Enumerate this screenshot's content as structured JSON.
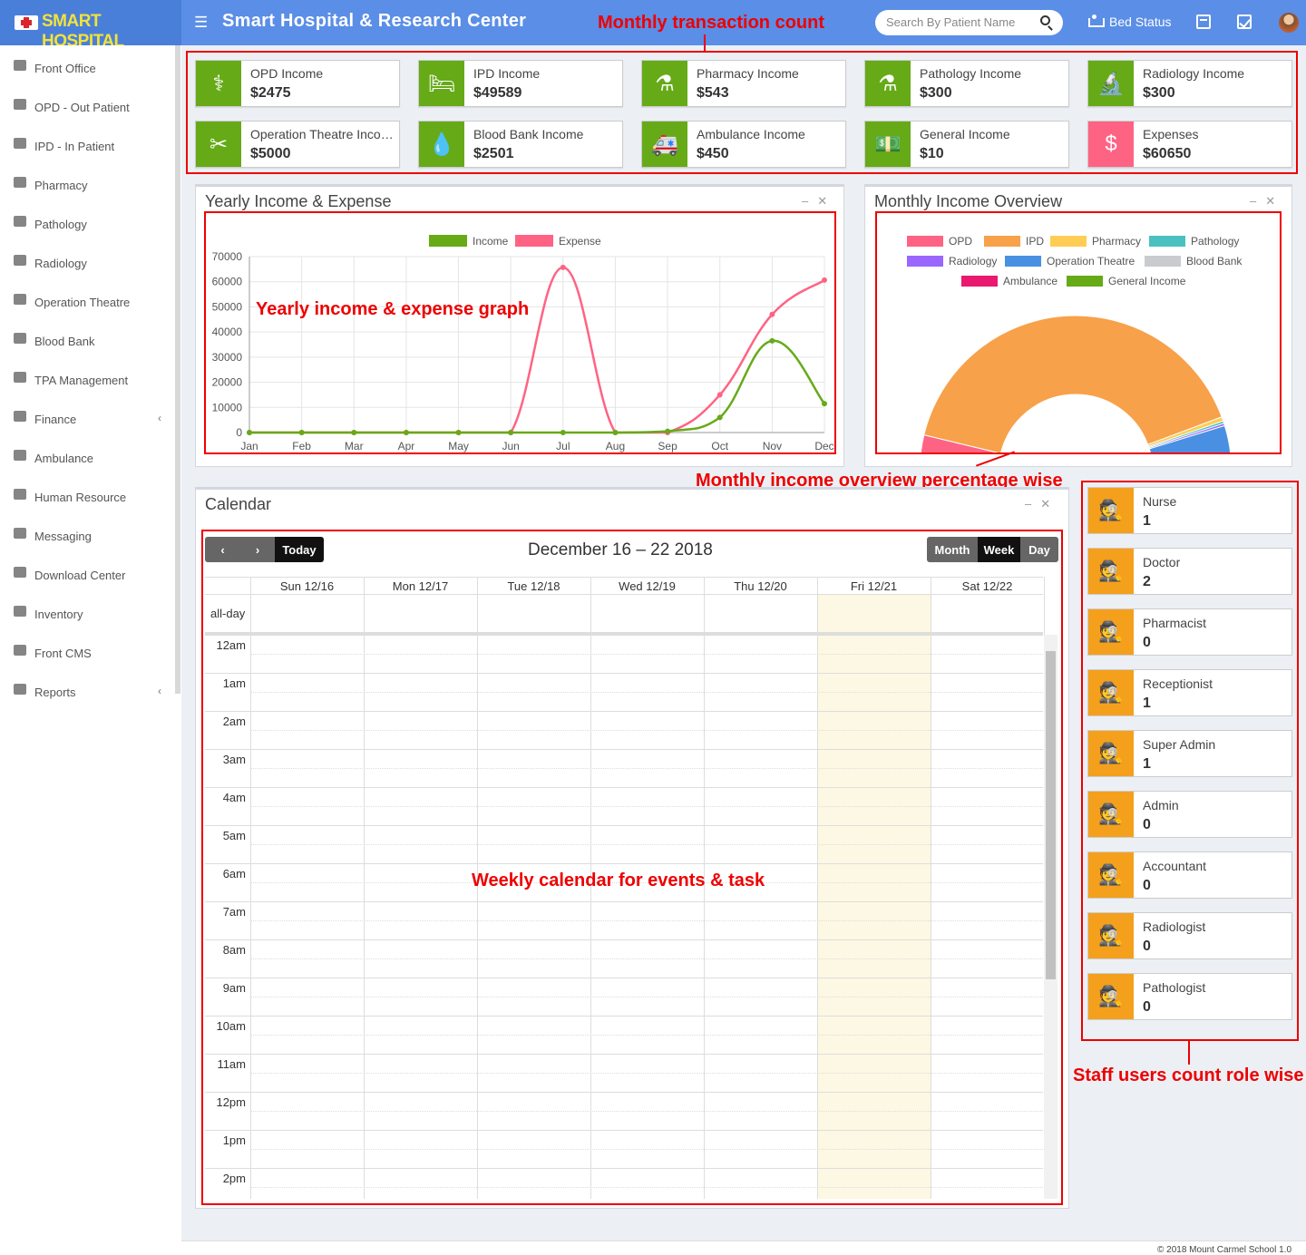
{
  "header": {
    "logo": "SMART HOSPITAL",
    "title": "Smart Hospital & Research Center",
    "search_placeholder": "Search By Patient Name",
    "bed_status": "Bed Status"
  },
  "sidebar": {
    "items": [
      {
        "label": "Front Office"
      },
      {
        "label": "OPD - Out Patient"
      },
      {
        "label": "IPD - In Patient"
      },
      {
        "label": "Pharmacy"
      },
      {
        "label": "Pathology"
      },
      {
        "label": "Radiology"
      },
      {
        "label": "Operation Theatre"
      },
      {
        "label": "Blood Bank"
      },
      {
        "label": "TPA Management"
      },
      {
        "label": "Finance",
        "chevron": "‹"
      },
      {
        "label": "Ambulance"
      },
      {
        "label": "Human Resource"
      },
      {
        "label": "Messaging"
      },
      {
        "label": "Download Center"
      },
      {
        "label": "Inventory"
      },
      {
        "label": "Front CMS"
      },
      {
        "label": "Reports",
        "chevron": "‹"
      }
    ]
  },
  "income_boxes": [
    {
      "label": "OPD Income",
      "value": "$2475",
      "icon": "stethoscope-icon",
      "glyph": "⚕"
    },
    {
      "label": "IPD Income",
      "value": "$49589",
      "icon": "bed-icon",
      "glyph": "🛏"
    },
    {
      "label": "Pharmacy Income",
      "value": "$543",
      "icon": "mortar-pestle-icon",
      "glyph": "⚗"
    },
    {
      "label": "Pathology Income",
      "value": "$300",
      "icon": "flask-icon",
      "glyph": "⚗"
    },
    {
      "label": "Radiology Income",
      "value": "$300",
      "icon": "microscope-icon",
      "glyph": "🔬"
    },
    {
      "label": "Operation Theatre Income",
      "value": "$5000",
      "icon": "scissors-icon",
      "glyph": "✂"
    },
    {
      "label": "Blood Bank Income",
      "value": "$2501",
      "icon": "blood-drop-icon",
      "glyph": "💧"
    },
    {
      "label": "Ambulance Income",
      "value": "$450",
      "icon": "ambulance-icon",
      "glyph": "🚑"
    },
    {
      "label": "General Income",
      "value": "$10",
      "icon": "money-icon",
      "glyph": "💵"
    },
    {
      "label": "Expenses",
      "value": "$60650",
      "icon": "dollar-circle-icon",
      "glyph": "$"
    }
  ],
  "colors": {
    "income_green": "#66aa18",
    "expense_pink": "#ff6384",
    "staff_orange": "#f4a01c",
    "topbar": "#5b8ee6"
  },
  "yearly": {
    "title": "Yearly Income & Expense"
  },
  "chart_data": [
    {
      "type": "line",
      "x": [
        "Jan",
        "Feb",
        "Mar",
        "Apr",
        "May",
        "Jun",
        "Jul",
        "Aug",
        "Sep",
        "Oct",
        "Nov",
        "Dec"
      ],
      "series": [
        {
          "name": "Income",
          "color": "#66aa18",
          "values": [
            0,
            0,
            0,
            0,
            0,
            0,
            0,
            0,
            500,
            6000,
            36500,
            11500
          ]
        },
        {
          "name": "Expense",
          "color": "#ff6384",
          "values": [
            0,
            0,
            0,
            0,
            0,
            0,
            65700,
            0,
            0,
            15000,
            47000,
            60650
          ]
        }
      ],
      "yticks": [
        "70000",
        "60000",
        "50000",
        "40000",
        "30000",
        "20000",
        "10000",
        "0"
      ],
      "ylim": [
        0,
        70000
      ]
    },
    {
      "type": "pie",
      "subtype": "half-doughnut",
      "labels": [
        "OPD",
        "IPD",
        "Pharmacy",
        "Pathology",
        "Radiology",
        "Operation Theatre",
        "Blood Bank",
        "Ambulance",
        "General Income"
      ],
      "colors": [
        "#ff6384",
        "#f7a14a",
        "#ffcd56",
        "#4bc0c0",
        "#9966ff",
        "#4a90e2",
        "#c9cbcf",
        "#e8196e",
        "#66aa18"
      ],
      "values": [
        2475,
        49589,
        543,
        300,
        300,
        5000,
        2501,
        450,
        10
      ]
    }
  ],
  "monthly": {
    "title": "Monthly Income Overview"
  },
  "calendar": {
    "title": "Calendar",
    "range": "December 16 – 22 2018",
    "today": "Today",
    "views": [
      "Month",
      "Week",
      "Day"
    ],
    "days": [
      "Sun 12/16",
      "Mon 12/17",
      "Tue 12/18",
      "Wed 12/19",
      "Thu 12/20",
      "Fri 12/21",
      "Sat 12/22"
    ],
    "allday": "all-day",
    "hours": [
      "12am",
      "1am",
      "2am",
      "3am",
      "4am",
      "5am",
      "6am",
      "7am",
      "8am",
      "9am",
      "10am",
      "11am",
      "12pm",
      "1pm",
      "2pm"
    ]
  },
  "staff": [
    {
      "role": "Nurse",
      "count": "1"
    },
    {
      "role": "Doctor",
      "count": "2"
    },
    {
      "role": "Pharmacist",
      "count": "0"
    },
    {
      "role": "Receptionist",
      "count": "1"
    },
    {
      "role": "Super Admin",
      "count": "1"
    },
    {
      "role": "Admin",
      "count": "0"
    },
    {
      "role": "Accountant",
      "count": "0"
    },
    {
      "role": "Radiologist",
      "count": "0"
    },
    {
      "role": "Pathologist",
      "count": "0"
    }
  ],
  "annotations": {
    "monthly_count": "Monthly transaction count",
    "yearly_graph": "Yearly income & expense graph",
    "monthly_overview": "Monthly income overview percentage wise",
    "weekly_calendar": "Weekly calendar for events & task",
    "staff_count": "Staff users count role wise"
  },
  "footer": {
    "copyright": "© 2018 Mount Carmel School 1.0"
  }
}
